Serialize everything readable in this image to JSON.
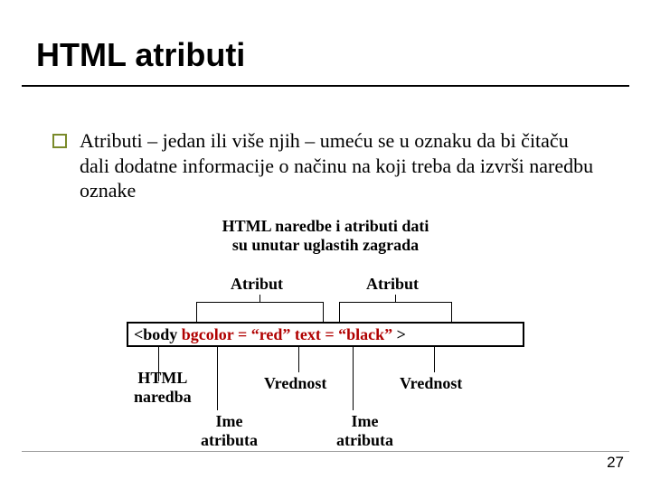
{
  "title": "HTML atributi",
  "bullet": "Atributi – jedan ili više njih – umeću se u oznaku da bi čitaču dali dodatne informacije o načinu na koji treba da izvrši naredbu oznake",
  "caption_line1": "HTML naredbe i atributi dati",
  "caption_line2": "su unutar uglastih zagrada",
  "labels": {
    "atribut_left": "Atribut",
    "atribut_right": "Atribut",
    "html_naredba_line1": "HTML",
    "html_naredba_line2": "naredba",
    "vrednost_left": "Vrednost",
    "vrednost_right": "Vrednost",
    "ime_atributa_left_line1": "Ime",
    "ime_atributa_left_line2": "atributa",
    "ime_atributa_right_line1": "Ime",
    "ime_atributa_right_line2": "atributa"
  },
  "code": {
    "open": "<",
    "tag": "body",
    "sp1": " ",
    "attr1_name": "bgcolor",
    "eq1": " = ",
    "attr1_val": "“red”",
    "sp2": " ",
    "attr2_name": "text",
    "eq2": " = ",
    "attr2_val": "“black”",
    "sp3": " ",
    "close": ">"
  },
  "slide_number": "27"
}
